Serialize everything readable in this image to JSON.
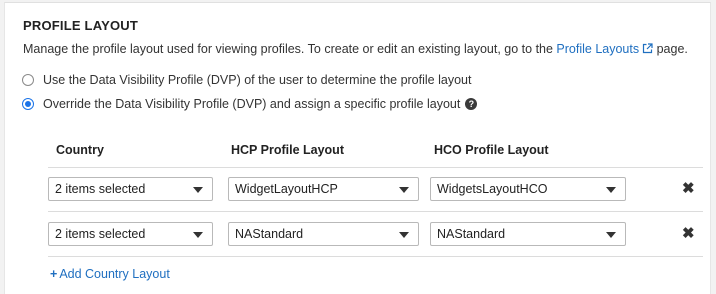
{
  "section": {
    "title": "PROFILE LAYOUT",
    "description_prefix": "Manage the profile layout used for viewing profiles. To create or edit an existing layout, go to the ",
    "description_link": "Profile Layouts",
    "description_suffix": " page."
  },
  "options": [
    {
      "label": "Use the Data Visibility Profile (DVP) of the user to determine the profile layout",
      "checked": false
    },
    {
      "label": "Override the Data Visibility Profile (DVP) and assign a specific profile layout",
      "checked": true
    }
  ],
  "table": {
    "headers": [
      "Country",
      "HCP Profile Layout",
      "HCO Profile Layout"
    ],
    "rows": [
      {
        "country": "2 items selected",
        "hcp": "WidgetLayoutHCP",
        "hco": "WidgetsLayoutHCO",
        "remove_icon": "close-icon"
      },
      {
        "country": "2 items selected",
        "hcp": "NAStandard",
        "hco": "NAStandard",
        "remove_icon": "close-icon"
      }
    ]
  },
  "add_link": "Add Country Layout",
  "colors": {
    "link": "#1f6fc0",
    "radio_accent": "#1a73e8"
  }
}
